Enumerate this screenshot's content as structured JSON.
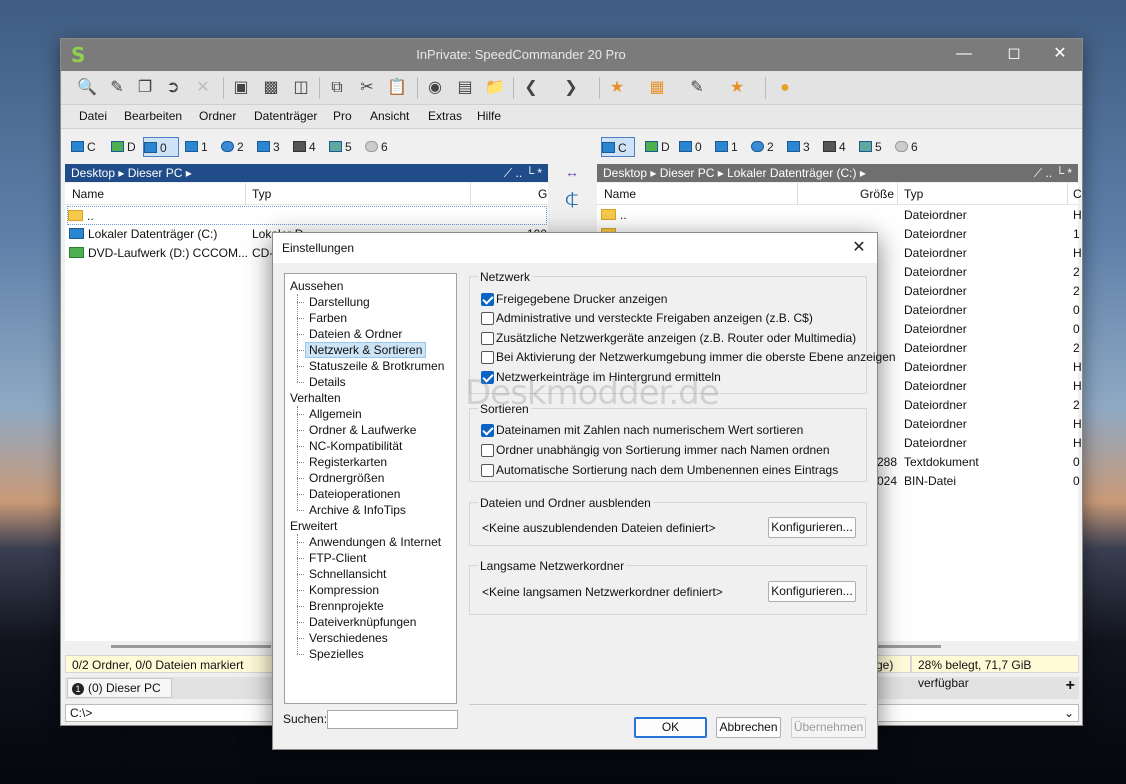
{
  "window": {
    "title": "InPrivate: SpeedCommander 20 Pro"
  },
  "menu": [
    "Datei",
    "Bearbeiten",
    "Ordner",
    "Datenträger",
    "Pro",
    "Ansicht",
    "Extras",
    "Hilfe"
  ],
  "drives": [
    "C",
    "D",
    "0",
    "1",
    "2",
    "3",
    "4",
    "5",
    "6"
  ],
  "left_panel": {
    "path": [
      "Desktop",
      "Dieser PC"
    ],
    "col_name": "Name",
    "col_type": "Typ",
    "col_third": "G",
    "rows": [
      {
        "name": "..",
        "type": "",
        "extra": ""
      },
      {
        "name": "Lokaler Datenträger (C:)",
        "type": "Lokaler D",
        "extra": "100"
      },
      {
        "name": "DVD-Laufwerk (D:) CCCOM...",
        "type": "CD-",
        "extra": ""
      }
    ],
    "status": "0/2 Ordner, 0/0 Dateien markiert",
    "tab": "(0) Dieser PC"
  },
  "right_panel": {
    "path": [
      "Desktop",
      "Dieser PC",
      "Lokaler Datenträger (C:)"
    ],
    "col_name": "Name",
    "col_size": "Größe",
    "col_type": "Typ",
    "col_last": "C",
    "rows": [
      {
        "name": "..",
        "size": "",
        "type": "Dateiordner",
        "last": "H"
      },
      {
        "name": "",
        "size": "",
        "type": "Dateiordner",
        "last": "1"
      },
      {
        "name": "",
        "size": "",
        "type": "Dateiordner",
        "last": "H"
      },
      {
        "name": "",
        "size": "",
        "type": "Dateiordner",
        "last": "2"
      },
      {
        "name": "",
        "size": "",
        "type": "Dateiordner",
        "last": "2"
      },
      {
        "name": "",
        "size": "",
        "type": "Dateiordner",
        "last": "0"
      },
      {
        "name": "",
        "size": "",
        "type": "Dateiordner",
        "last": "0"
      },
      {
        "name": "",
        "size": "",
        "type": "Dateiordner",
        "last": "2"
      },
      {
        "name": "",
        "size": "",
        "type": "Dateiordner",
        "last": "H"
      },
      {
        "name": "",
        "size": "",
        "type": "Dateiordner",
        "last": "H"
      },
      {
        "name": "",
        "size": "",
        "type": "Dateiordner",
        "last": "2"
      },
      {
        "name": "",
        "size": "",
        "type": "Dateiordner",
        "last": "H"
      },
      {
        "name": "",
        "size": "",
        "type": "Dateiordner",
        "last": "H"
      },
      {
        "name": "",
        "size": "288",
        "type": "Textdokument",
        "last": "0"
      },
      {
        "name": "",
        "size": "024",
        "type": "BIN-Datei",
        "last": "0"
      }
    ],
    "status_left": "ge)",
    "status_right": "28% belegt, 71,7 GiB verfügbar"
  },
  "cmdline": "C:\\>",
  "dialog": {
    "title": "Einstellungen",
    "tree": [
      {
        "label": "Aussehen",
        "level": 0
      },
      {
        "label": "Darstellung",
        "level": 1
      },
      {
        "label": "Farben",
        "level": 1
      },
      {
        "label": "Dateien & Ordner",
        "level": 1
      },
      {
        "label": "Netzwerk & Sortieren",
        "level": 1,
        "selected": true
      },
      {
        "label": "Statuszeile & Brotkrumen",
        "level": 1
      },
      {
        "label": "Details",
        "level": 1
      },
      {
        "label": "Verhalten",
        "level": 0
      },
      {
        "label": "Allgemein",
        "level": 1
      },
      {
        "label": "Ordner & Laufwerke",
        "level": 1
      },
      {
        "label": "NC-Kompatibilität",
        "level": 1
      },
      {
        "label": "Registerkarten",
        "level": 1
      },
      {
        "label": "Ordnergrößen",
        "level": 1
      },
      {
        "label": "Dateioperationen",
        "level": 1
      },
      {
        "label": "Archive & InfoTips",
        "level": 1
      },
      {
        "label": "Erweitert",
        "level": 0
      },
      {
        "label": "Anwendungen & Internet",
        "level": 1
      },
      {
        "label": "FTP-Client",
        "level": 1
      },
      {
        "label": "Schnellansicht",
        "level": 1
      },
      {
        "label": "Kompression",
        "level": 1
      },
      {
        "label": "Brennprojekte",
        "level": 1
      },
      {
        "label": "Dateiverknüpfungen",
        "level": 1
      },
      {
        "label": "Verschiedenes",
        "level": 1
      },
      {
        "label": "Spezielles",
        "level": 1
      }
    ],
    "search_label": "Suchen:",
    "search_value": "",
    "groups": {
      "netzwerk": {
        "title": "Netzwerk",
        "options": [
          {
            "label": "Freigegebene Drucker anzeigen",
            "checked": true
          },
          {
            "label": "Administrative und versteckte Freigaben anzeigen (z.B. C$)",
            "checked": false
          },
          {
            "label": "Zusätzliche Netzwerkgeräte anzeigen (z.B. Router oder Multimedia)",
            "checked": false
          },
          {
            "label": "Bei Aktivierung der Netzwerkumgebung immer die oberste Ebene anzeigen",
            "checked": false
          },
          {
            "label": "Netzwerkeinträge im Hintergrund ermitteln",
            "checked": true
          }
        ]
      },
      "sortieren": {
        "title": "Sortieren",
        "options": [
          {
            "label": "Dateinamen mit Zahlen nach numerischem Wert sortieren",
            "checked": true
          },
          {
            "label": "Ordner unabhängig von Sortierung immer nach Namen ordnen",
            "checked": false
          },
          {
            "label": "Automatische Sortierung nach dem Umbenennen eines Eintrags",
            "checked": false
          }
        ]
      },
      "ausblenden": {
        "title": "Dateien und Ordner ausblenden",
        "text": "<Keine auszublendenden Dateien definiert>",
        "button": "Konfigurieren..."
      },
      "langsam": {
        "title": "Langsame Netzwerkordner",
        "text": "<Keine langsamen Netzwerkordner definiert>",
        "button": "Konfigurieren..."
      }
    },
    "buttons": {
      "ok": "OK",
      "cancel": "Abbrechen",
      "apply": "Übernehmen"
    }
  },
  "watermark": "Deskmodder.de"
}
